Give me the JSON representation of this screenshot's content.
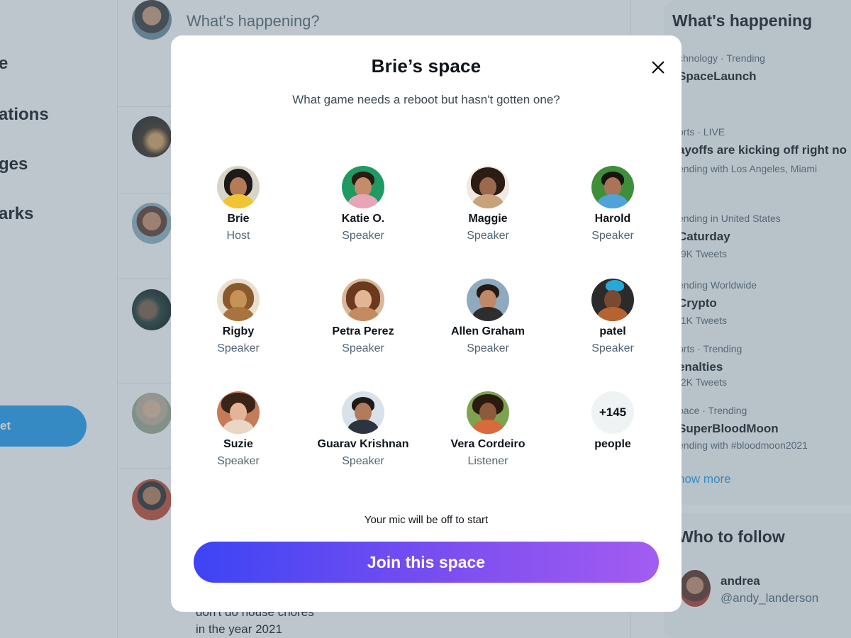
{
  "background": {
    "compose_placeholder": "What's happening?",
    "nav_items": [
      "e",
      "ations",
      "ges",
      "arks"
    ],
    "tweet_button_label": "et",
    "feed_text_lines": [
      "don't do house chores",
      "in the year 2021"
    ],
    "trends": {
      "title": "What's happening",
      "items": [
        {
          "meta": "chnology · Trending",
          "topic": "SpaceLaunch",
          "sub": ""
        },
        {
          "meta": "orts · LIVE",
          "topic": "ayoffs are kicking off right no",
          "sub": "ending with Los Angeles, Miami"
        },
        {
          "meta": "ending in United States",
          "topic": "Caturday",
          "sub": ".9K Tweets"
        },
        {
          "meta": "ending Worldwide",
          "topic": "Crypto",
          "sub": ".1K Tweets"
        },
        {
          "meta": "orts · Trending",
          "topic": "enalties",
          "sub": ".2K Tweets"
        },
        {
          "meta": "pace · Trending",
          "topic": "SuperBloodMoon",
          "sub": "ending with #bloodmoon2021"
        }
      ],
      "show_more": "how more"
    },
    "who_to_follow": {
      "title": "Who to follow",
      "name": "andrea",
      "handle": "@andy_landerson"
    }
  },
  "modal": {
    "title": "Brie’s space",
    "question": "What game needs a reboot but hasn't gotten one?",
    "participants": [
      {
        "name": "Brie",
        "role": "Host"
      },
      {
        "name": "Katie O.",
        "role": "Speaker"
      },
      {
        "name": "Maggie",
        "role": "Speaker"
      },
      {
        "name": "Harold",
        "role": "Speaker"
      },
      {
        "name": "Rigby",
        "role": "Speaker"
      },
      {
        "name": "Petra Perez",
        "role": "Speaker"
      },
      {
        "name": "Allen Graham",
        "role": "Speaker"
      },
      {
        "name": "patel",
        "role": "Speaker"
      },
      {
        "name": "Suzie",
        "role": "Speaker"
      },
      {
        "name": "Guarav Krishnan",
        "role": "Speaker"
      },
      {
        "name": "Vera Cordeiro",
        "role": "Listener"
      }
    ],
    "more_count": "+145",
    "more_label": "people",
    "mic_note": "Your mic will be off to start",
    "join_label": "Join this space"
  },
  "colors": {
    "overlay": "#5b7083",
    "accent_blue": "#1d9bf0",
    "join_gradient_start": "#3d44f5",
    "join_gradient_end": "#a35cf1"
  },
  "icons": {
    "close": "close-icon"
  }
}
